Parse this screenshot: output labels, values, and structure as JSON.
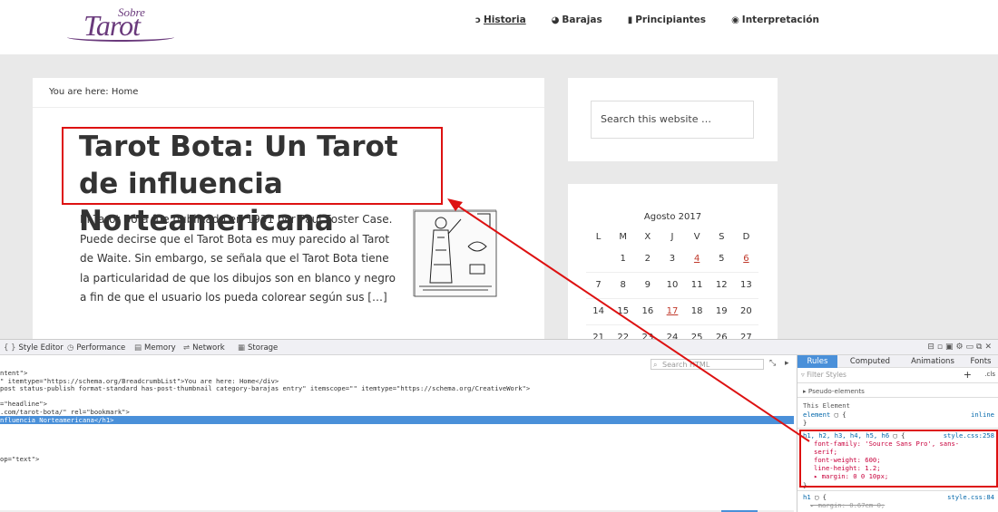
{
  "site": {
    "logo_top": "Sobre",
    "logo_main": "Tarot",
    "nav": [
      {
        "label": "Historia",
        "icon": "ↄ",
        "active": true
      },
      {
        "label": "Barajas",
        "icon": "◕",
        "active": false
      },
      {
        "label": "Principiantes",
        "icon": "▮",
        "active": false
      },
      {
        "label": "Interpretación",
        "icon": "◉",
        "active": false
      }
    ]
  },
  "article": {
    "breadcrumb": "You are here: Home",
    "title": "Tarot Bota: Un Tarot de influencia Norteamericana",
    "excerpt": "El Tarot Bota fue publicado en 1931 por Paul Foster Case.  Puede decirse que el Tarot Bota es muy parecido al Tarot de Waite.  Sin embargo, se señala que el Tarot Bota tiene la particularidad de que los dibujos son en blanco y negro a fin de que el usuario los pueda colorear según sus […]"
  },
  "sidebar": {
    "search_placeholder": "Search this website …",
    "calendar": {
      "month": "Agosto 2017",
      "days": [
        "L",
        "M",
        "X",
        "J",
        "V",
        "S",
        "D"
      ],
      "rows": [
        [
          "",
          "1",
          "2",
          "3",
          "4",
          "5",
          "6"
        ],
        [
          "7",
          "8",
          "9",
          "10",
          "11",
          "12",
          "13"
        ],
        [
          "14",
          "15",
          "16",
          "17",
          "18",
          "19",
          "20"
        ],
        [
          "21",
          "22",
          "23",
          "24",
          "25",
          "26",
          "27"
        ]
      ],
      "links": [
        "4",
        "6",
        "17"
      ]
    }
  },
  "devtools": {
    "tabs": [
      {
        "label": "Style Editor",
        "glyph": "{ }"
      },
      {
        "label": "Performance",
        "glyph": "◷"
      },
      {
        "label": "Memory",
        "glyph": "▤"
      },
      {
        "label": "Network",
        "glyph": "⇌"
      },
      {
        "label": "Storage",
        "glyph": "▦"
      }
    ],
    "search_html": "Search HTML",
    "markup_lines": [
      {
        "text": "ntent\">",
        "sel": false
      },
      {
        "text": "\" itemtype=\"https://schema.org/BreadcrumbList\">You are here: Home</div>",
        "sel": false
      },
      {
        "text": "post status-publish format-standard has-post-thumbnail category-barajas entry\" itemscope=\"\" itemtype=\"https://schema.org/CreativeWork\">",
        "sel": false
      },
      {
        "text": "",
        "sel": false
      },
      {
        "text": "=\"headline\">",
        "sel": false
      },
      {
        "text": ".com/tarot-bota/\" rel=\"bookmark\">",
        "sel": false
      },
      {
        "text": "nfluencia Norteamericana</h1>",
        "sel": true
      },
      {
        "text": "",
        "sel": false
      },
      {
        "text": "",
        "sel": false
      },
      {
        "text": "",
        "sel": false
      },
      {
        "text": "",
        "sel": false
      },
      {
        "text": "op=\"text\">",
        "sel": false
      }
    ],
    "rule_tabs": [
      "Rules",
      "Computed",
      "Animations",
      "Fonts"
    ],
    "filter_styles": "Filter Styles",
    "cls_label": ".cls",
    "pseudo": "Pseudo-elements",
    "this_element": "This Element",
    "element_rule": "element",
    "inline_label": "inline",
    "h_rule": {
      "selector": "h1, h2, h3, h4, h5, h6",
      "source": "style.css:258",
      "decls": [
        "font-family: 'Source Sans Pro', sans-",
        "serif;",
        "font-weight: 600;",
        "line-height: 1.2;",
        "▸ margin: 0 0 10px;"
      ]
    },
    "h1_rule": {
      "selector": "h1",
      "source": "style.css:84",
      "decl": "▸ margin: 0.67em 0;"
    }
  }
}
